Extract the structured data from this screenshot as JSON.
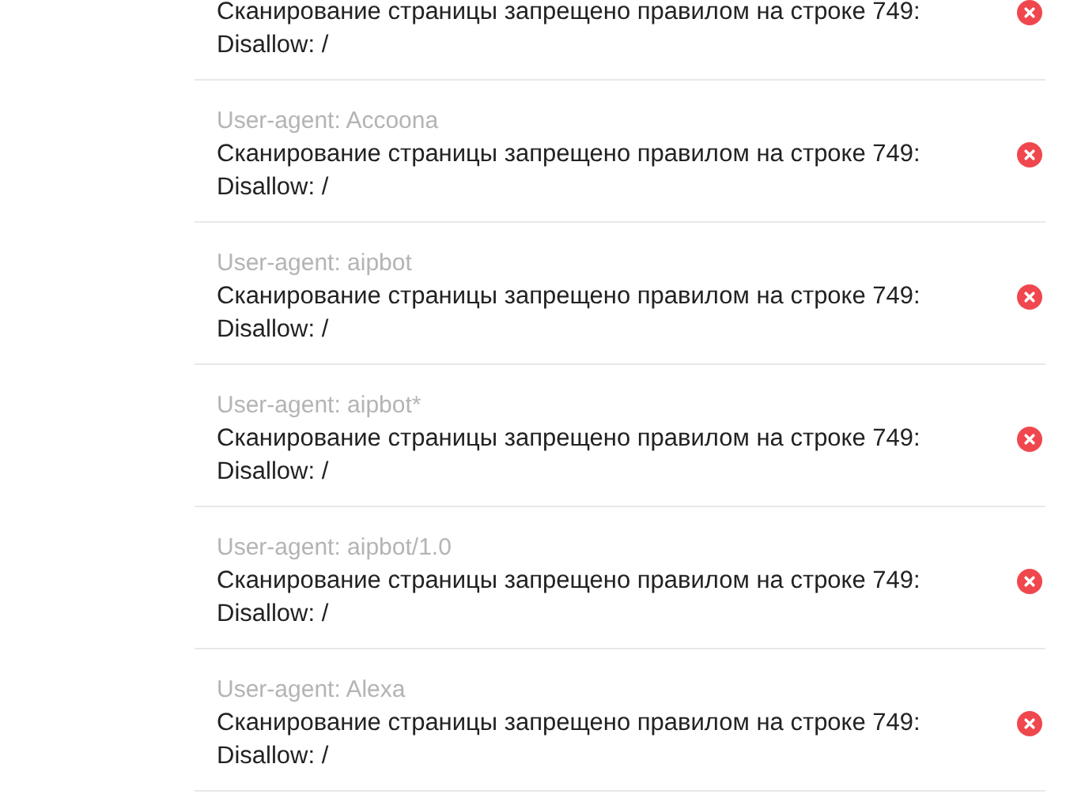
{
  "results": [
    {
      "message": "Сканирование страницы запрещено правилом на строке 749:",
      "rule": "Disallow: /",
      "blocked": true
    },
    {
      "agent": "User-agent: Accoona",
      "message": "Сканирование страницы запрещено правилом на строке 749:",
      "rule": "Disallow: /",
      "blocked": true
    },
    {
      "agent": "User-agent: aipbot",
      "message": "Сканирование страницы запрещено правилом на строке 749:",
      "rule": "Disallow: /",
      "blocked": true
    },
    {
      "agent": "User-agent: aipbot*",
      "message": "Сканирование страницы запрещено правилом на строке 749:",
      "rule": "Disallow: /",
      "blocked": true
    },
    {
      "agent": "User-agent: aipbot/1.0",
      "message": "Сканирование страницы запрещено правилом на строке 749:",
      "rule": "Disallow: /",
      "blocked": true
    },
    {
      "agent": "User-agent: Alexa",
      "message": "Сканирование страницы запрещено правилом на строке 749:",
      "rule": "Disallow: /",
      "blocked": true
    }
  ]
}
